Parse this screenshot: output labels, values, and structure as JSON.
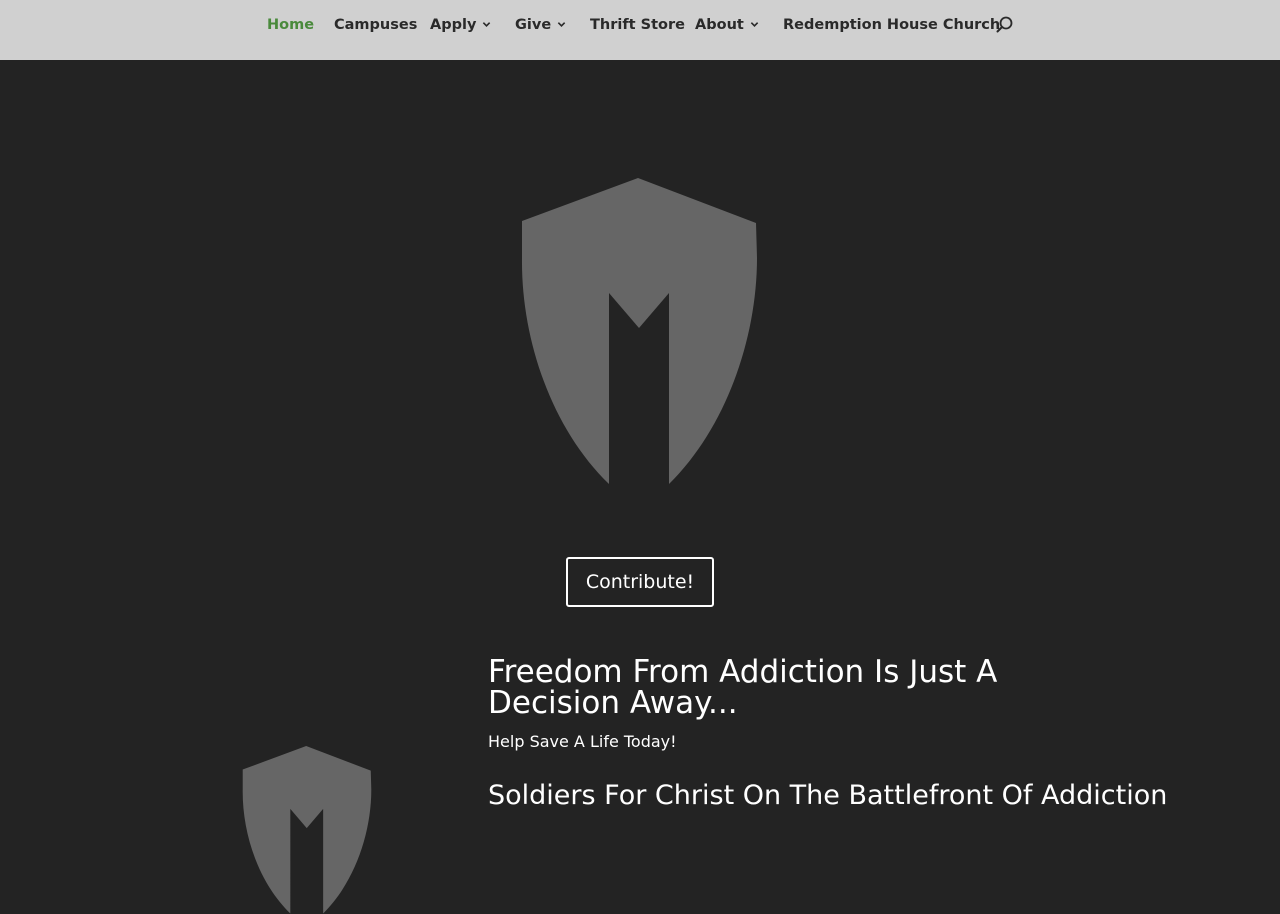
{
  "nav": {
    "items": [
      {
        "label": "Home",
        "active": true,
        "has_dropdown": false
      },
      {
        "label": "Campuses",
        "active": false,
        "has_dropdown": false
      },
      {
        "label": "Apply",
        "active": false,
        "has_dropdown": true
      },
      {
        "label": "Give",
        "active": false,
        "has_dropdown": true
      },
      {
        "label": "Thrift Store",
        "active": false,
        "has_dropdown": false
      },
      {
        "label": "About",
        "active": false,
        "has_dropdown": true
      },
      {
        "label": "Redemption House Church",
        "active": false,
        "has_dropdown": false
      }
    ],
    "search_icon": "search-icon",
    "active_color": "#4a8a3c"
  },
  "hero": {
    "logo_icon": "spartan-helmet-icon",
    "button_label": "Contribute!"
  },
  "content": {
    "headline": "Freedom From Addiction Is Just A Decision Away...",
    "subheadline": "Help Save A Life Today!",
    "headline2": "Soldiers For Christ On The Battlefront Of Addiction"
  },
  "colors": {
    "background": "#232323",
    "nav_background": "#d0d0d0",
    "logo": "#666666"
  }
}
